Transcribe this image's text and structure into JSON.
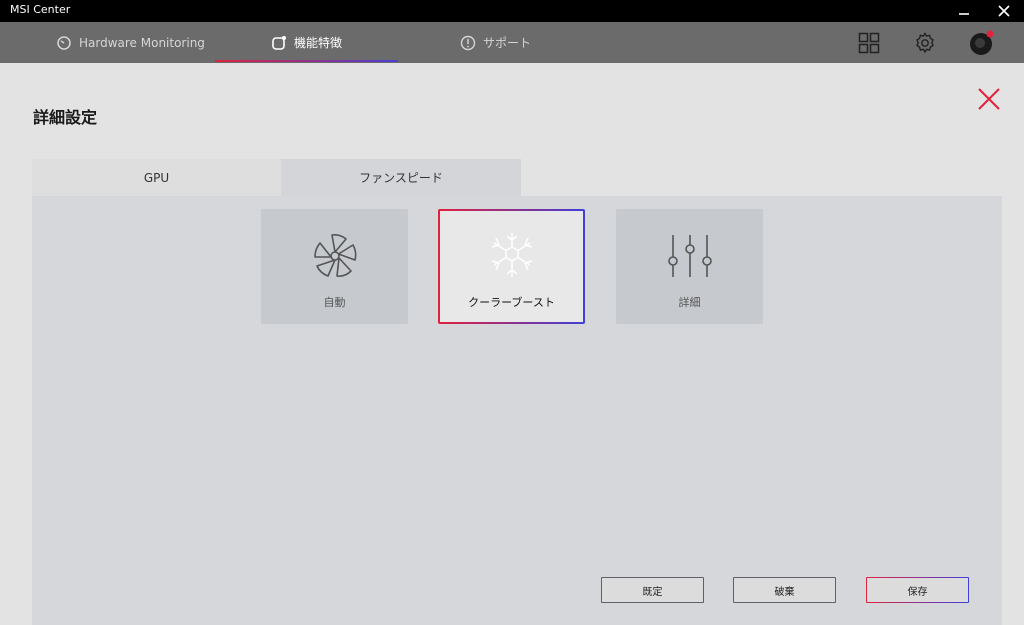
{
  "window": {
    "title": "MSI Center",
    "minimize_icon": "minimize-icon",
    "close_icon": "close-icon"
  },
  "nav": {
    "tabs": [
      {
        "label": "Hardware Monitoring",
        "icon": "gauge-icon",
        "active": false
      },
      {
        "label": "機能特徴",
        "icon": "feature-icon",
        "active": true
      },
      {
        "label": "サポート",
        "icon": "support-icon",
        "active": false
      }
    ],
    "right_icons": [
      "grid-icon",
      "gear-icon",
      "avatar-icon"
    ]
  },
  "page": {
    "title": "詳細設定",
    "close_icon": "close-x-icon"
  },
  "subtabs": [
    {
      "label": "GPU",
      "active": false
    },
    {
      "label": "ファンスピード",
      "active": true
    }
  ],
  "modes": [
    {
      "label": "自動",
      "icon": "fan-icon",
      "selected": false
    },
    {
      "label": "クーラーブースト",
      "icon": "snowflake-icon",
      "selected": true
    },
    {
      "label": "詳細",
      "icon": "sliders-icon",
      "selected": false
    }
  ],
  "buttons": {
    "default": "既定",
    "discard": "破棄",
    "save": "保存"
  },
  "colors": {
    "accent_red": "#e0223e",
    "accent_blue": "#3f3fd8",
    "titlebar": "#000000",
    "navbar": "#6b6b6b"
  }
}
